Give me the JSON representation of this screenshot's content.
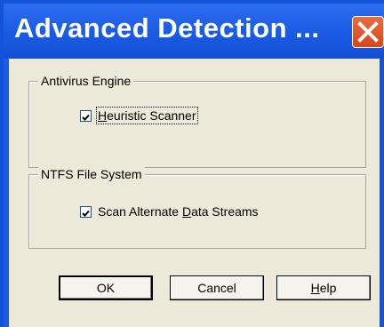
{
  "window": {
    "title": "Advanced Detection ..."
  },
  "icons": {
    "close": "close-icon",
    "check": "checkmark-icon"
  },
  "colors": {
    "titlebar": "#1a5ce4",
    "close_button": "#d8461a",
    "client_bg": "#ece9d8"
  },
  "groups": {
    "antivirus": {
      "label": "Antivirus Engine",
      "heuristic": {
        "label_pre": "",
        "label_mnemonic": "H",
        "label_post": "euristic Scanner",
        "checked": true
      }
    },
    "ntfs": {
      "label": "NTFS File System",
      "ads": {
        "label_pre": "Scan Alternate ",
        "label_mnemonic": "D",
        "label_post": "ata Streams",
        "checked": true
      }
    }
  },
  "buttons": {
    "ok": "OK",
    "cancel": "Cancel",
    "help_mnemonic": "H",
    "help_rest": "elp"
  }
}
